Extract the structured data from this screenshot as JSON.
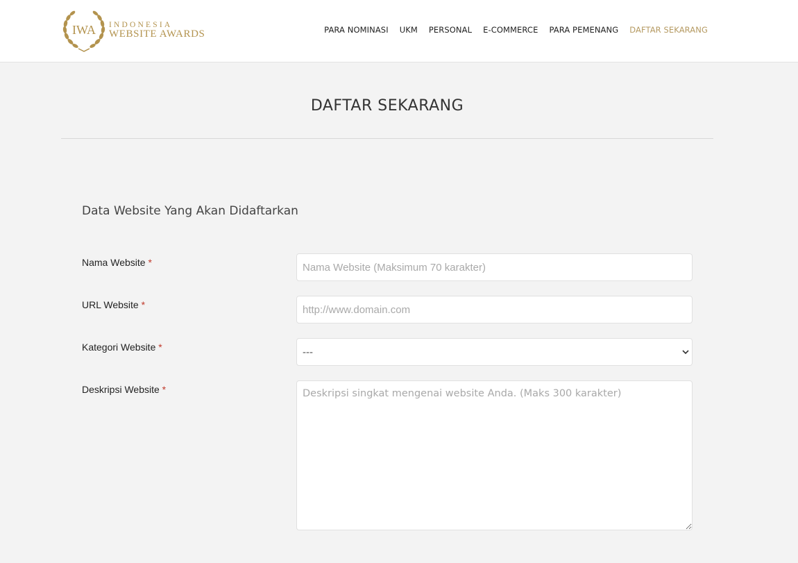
{
  "brand": {
    "logo_monogram": "IWA",
    "logo_line1": "INDONESIA",
    "logo_line2": "WEBSITE AWARDS"
  },
  "nav": {
    "items": [
      {
        "label": "PARA NOMINASI"
      },
      {
        "label": "UKM"
      },
      {
        "label": "PERSONAL"
      },
      {
        "label": "E-COMMERCE"
      },
      {
        "label": "PARA PEMENANG"
      },
      {
        "label": "DAFTAR SEKARANG"
      }
    ],
    "active_index": 5
  },
  "page": {
    "title": "DAFTAR SEKARANG"
  },
  "form": {
    "section_heading": "Data Website Yang Akan Didaftarkan",
    "required_marker": "*",
    "fields": [
      {
        "label": "Nama Website",
        "placeholder": "Nama Website (Maksimum 70 karakter)",
        "value": ""
      },
      {
        "label": "URL Website",
        "placeholder": "http://www.domain.com",
        "value": ""
      },
      {
        "label": "Kategori Website",
        "selected": "---"
      },
      {
        "label": "Deskripsi Website",
        "placeholder": "Deskripsi singkat mengenai website Anda. (Maks 300 karakter)",
        "value": ""
      }
    ]
  },
  "colors": {
    "accent_gold": "#b59a62",
    "page_background": "#f3f3f3",
    "required_red": "#c0392b"
  },
  "icons": {
    "logo": "laurel-wreath-icon",
    "select": "chevron-down-icon"
  }
}
